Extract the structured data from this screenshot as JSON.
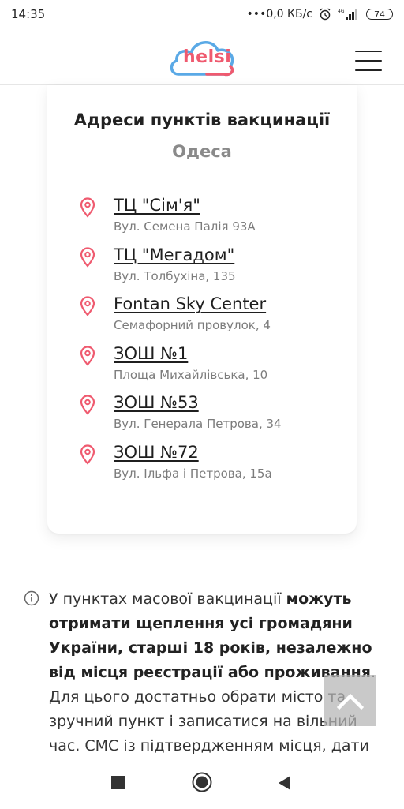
{
  "status_bar": {
    "time": "14:35",
    "network": "•••0,0 КБ/с",
    "battery": "74"
  },
  "header": {
    "logo_text": "helsi"
  },
  "card": {
    "title": "Адреси пунктів вакцинації",
    "city": "Одеса",
    "locations": [
      {
        "name": "ТЦ \"Сім'я\"",
        "address": "Вул. Семена Палія 93А"
      },
      {
        "name": "ТЦ \"Мегадом\"",
        "address": "Вул. Толбухіна, 135"
      },
      {
        "name": "Fontan Sky Center",
        "address": "Семафорний провулок, 4"
      },
      {
        "name": "ЗОШ №1",
        "address": "Площа Михайлівська, 10"
      },
      {
        "name": "ЗОШ №53",
        "address": "Вул. Генерала Петрова, 34"
      },
      {
        "name": "ЗОШ №72",
        "address": "Вул. Ільфа і Петрова, 15а"
      }
    ]
  },
  "info": {
    "text_intro": "У пунктах масової вакцинації ",
    "text_bold": "можуть отримати щеплення усі громадяни України, старші 18 років, незалежно від місця реєстрації або проживання",
    "text_rest": ". Для цього достатньо обрати місто та зручний пункт і записатися на вільний час. СМС із підтвердженням місця, дати та часу"
  },
  "colors": {
    "accent_pink": "#ef5a6f",
    "logo_blue": "#5aa9e6"
  }
}
